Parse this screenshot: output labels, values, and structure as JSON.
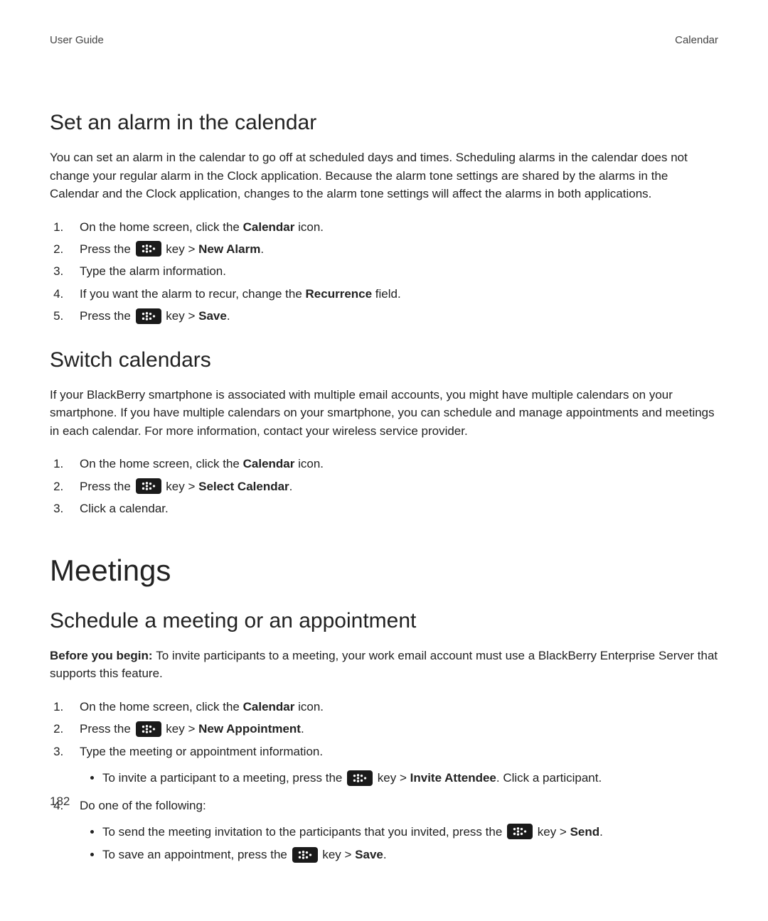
{
  "header": {
    "left": "User Guide",
    "right": "Calendar"
  },
  "s1": {
    "heading": "Set an alarm in the calendar",
    "para": "You can set an alarm in the calendar to go off at scheduled days and times. Scheduling alarms in the calendar does not change your regular alarm in the Clock application. Because the alarm tone settings are shared by the alarms in the Calendar and the Clock application, changes to the alarm tone settings will affect the alarms in both applications.",
    "step1_a": "On the home screen, click the ",
    "step1_b": "Calendar",
    "step1_c": " icon.",
    "step2_a": "Press the ",
    "step2_b": " key > ",
    "step2_c": "New Alarm",
    "step2_d": ".",
    "step3": "Type the alarm information.",
    "step4_a": "If you want the alarm to recur, change the ",
    "step4_b": "Recurrence",
    "step4_c": " field.",
    "step5_a": "Press the ",
    "step5_b": " key > ",
    "step5_c": "Save",
    "step5_d": "."
  },
  "s2": {
    "heading": "Switch calendars",
    "para": "If your BlackBerry smartphone is associated with multiple email accounts, you might have multiple calendars on your smartphone. If you have multiple calendars on your smartphone, you can schedule and manage appointments and meetings in each calendar. For more information, contact your wireless service provider.",
    "step1_a": "On the home screen, click the ",
    "step1_b": "Calendar",
    "step1_c": " icon.",
    "step2_a": "Press the ",
    "step2_b": " key > ",
    "step2_c": "Select Calendar",
    "step2_d": ".",
    "step3": "Click a calendar."
  },
  "meetings_heading": "Meetings",
  "s3": {
    "heading": "Schedule a meeting or an appointment",
    "before_label": "Before you begin: ",
    "before_text": "To invite participants to a meeting, your work email account must use a BlackBerry Enterprise Server that supports this feature.",
    "step1_a": "On the home screen, click the ",
    "step1_b": "Calendar",
    "step1_c": " icon.",
    "step2_a": "Press the ",
    "step2_b": " key > ",
    "step2_c": "New Appointment",
    "step2_d": ".",
    "step3": "Type the meeting or appointment information.",
    "step3_sub_a": "To invite a participant to a meeting, press the ",
    "step3_sub_b": " key > ",
    "step3_sub_c": "Invite Attendee",
    "step3_sub_d": ". Click a participant.",
    "step4": "Do one of the following:",
    "step4_sub1_a": "To send the meeting invitation to the participants that you invited, press the ",
    "step4_sub1_b": " key > ",
    "step4_sub1_c": "Send",
    "step4_sub1_d": ".",
    "step4_sub2_a": "To save an appointment, press the ",
    "step4_sub2_b": " key > ",
    "step4_sub2_c": "Save",
    "step4_sub2_d": "."
  },
  "page_number": "182"
}
